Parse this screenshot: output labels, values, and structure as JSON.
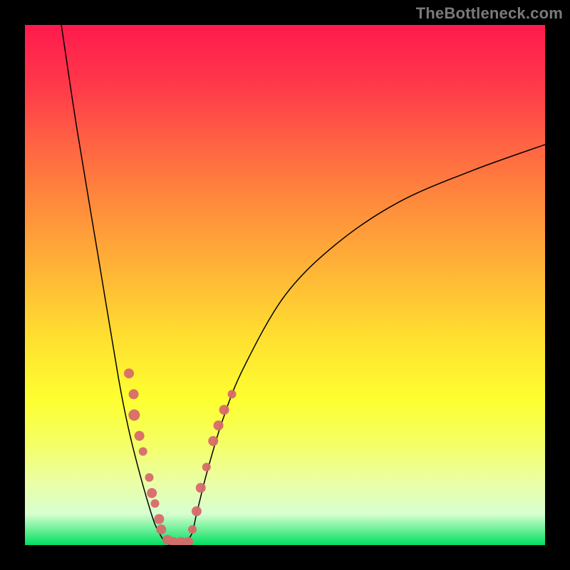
{
  "watermark": "TheBottleneck.com",
  "background": {
    "frame_color": "#000000",
    "gradient_stops": [
      {
        "pos": 0.0,
        "color": "#ff1a4d"
      },
      {
        "pos": 0.12,
        "color": "#ff3a4a"
      },
      {
        "pos": 0.22,
        "color": "#ff6044"
      },
      {
        "pos": 0.34,
        "color": "#ff8a3c"
      },
      {
        "pos": 0.47,
        "color": "#ffb437"
      },
      {
        "pos": 0.6,
        "color": "#ffdf30"
      },
      {
        "pos": 0.72,
        "color": "#fdff30"
      },
      {
        "pos": 0.8,
        "color": "#f5ff60"
      },
      {
        "pos": 0.88,
        "color": "#eaffa6"
      },
      {
        "pos": 0.94,
        "color": "#d8ffd0"
      },
      {
        "pos": 1.0,
        "color": "#00e060"
      }
    ]
  },
  "chart_data": {
    "type": "line",
    "title": "",
    "xlabel": "",
    "ylabel": "",
    "xlim": [
      0,
      100
    ],
    "ylim": [
      0,
      100
    ],
    "grid": false,
    "legend": false,
    "series": [
      {
        "name": "bottleneck-curve-left",
        "x": [
          7,
          10,
          14,
          18,
          20,
          22,
          24,
          25,
          26,
          27,
          28
        ],
        "y": [
          100,
          80,
          56,
          32,
          22,
          14,
          7,
          4,
          2,
          0.5,
          0
        ]
      },
      {
        "name": "bottleneck-curve-right",
        "x": [
          28,
          30,
          32,
          33,
          35,
          38,
          42,
          50,
          60,
          72,
          86,
          100
        ],
        "y": [
          0,
          0,
          2,
          6,
          14,
          24,
          34,
          48,
          58,
          66,
          72,
          77
        ]
      }
    ],
    "markers": {
      "name": "highlighted-points",
      "color": "#d76a6a",
      "points": [
        {
          "x": 20.0,
          "y": 33.0,
          "r": 7
        },
        {
          "x": 20.9,
          "y": 29.0,
          "r": 7
        },
        {
          "x": 21.0,
          "y": 25.0,
          "r": 8
        },
        {
          "x": 22.0,
          "y": 21.0,
          "r": 7
        },
        {
          "x": 22.7,
          "y": 18.0,
          "r": 6
        },
        {
          "x": 23.9,
          "y": 13.0,
          "r": 6
        },
        {
          "x": 24.4,
          "y": 10.0,
          "r": 7
        },
        {
          "x": 25.0,
          "y": 8.0,
          "r": 6
        },
        {
          "x": 25.8,
          "y": 5.0,
          "r": 7
        },
        {
          "x": 26.2,
          "y": 3.0,
          "r": 7
        },
        {
          "x": 27.4,
          "y": 1.0,
          "r": 7
        },
        {
          "x": 28.5,
          "y": 0.6,
          "r": 7
        },
        {
          "x": 30.0,
          "y": 0.6,
          "r": 7
        },
        {
          "x": 31.4,
          "y": 0.6,
          "r": 7
        },
        {
          "x": 32.2,
          "y": 3.0,
          "r": 6
        },
        {
          "x": 33.0,
          "y": 6.5,
          "r": 7
        },
        {
          "x": 33.8,
          "y": 11.0,
          "r": 7
        },
        {
          "x": 34.9,
          "y": 15.0,
          "r": 6
        },
        {
          "x": 36.2,
          "y": 20.0,
          "r": 7
        },
        {
          "x": 37.2,
          "y": 23.0,
          "r": 7
        },
        {
          "x": 38.3,
          "y": 26.0,
          "r": 7
        },
        {
          "x": 39.8,
          "y": 29.0,
          "r": 6
        }
      ]
    }
  }
}
